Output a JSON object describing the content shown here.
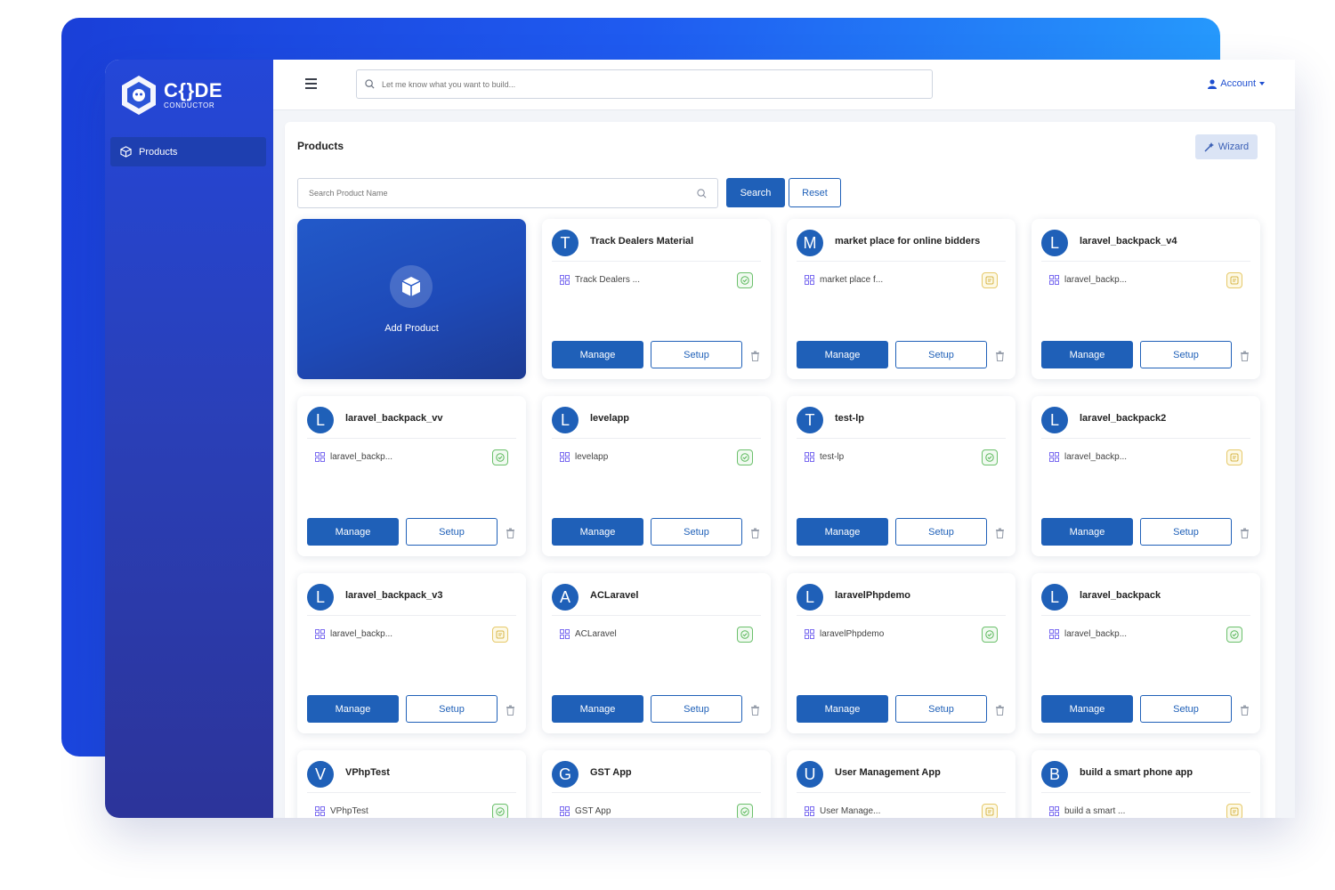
{
  "brand": {
    "name": "C{}DE",
    "tagline": "CONDUCTOR"
  },
  "sidebar": {
    "items": [
      {
        "label": "Products",
        "icon": "box-icon"
      }
    ]
  },
  "topbar": {
    "search_placeholder": "Let me know what you want to build...",
    "account_label": "Account"
  },
  "page": {
    "title": "Products",
    "wizard_label": "Wizard",
    "search_placeholder": "Search Product Name",
    "search_button": "Search",
    "reset_button": "Reset",
    "add_product_label": "Add Product"
  },
  "card_actions": {
    "manage": "Manage",
    "setup": "Setup"
  },
  "colors": {
    "primary": "#1f60b8",
    "sidebar": "#2a3fb6",
    "status_ok": "#6cc06c",
    "status_pending": "#e6c96a"
  },
  "products": [
    {
      "initial": "T",
      "name": "Track Dealers Material",
      "sub": "Track Dealers ...",
      "status": "ok"
    },
    {
      "initial": "M",
      "name": "market place for online bidders",
      "sub": "market place f...",
      "status": "pending"
    },
    {
      "initial": "L",
      "name": "laravel_backpack_v4",
      "sub": "laravel_backp...",
      "status": "pending"
    },
    {
      "initial": "L",
      "name": "laravel_backpack_vv",
      "sub": "laravel_backp...",
      "status": "ok"
    },
    {
      "initial": "L",
      "name": "levelapp",
      "sub": "levelapp",
      "status": "ok"
    },
    {
      "initial": "T",
      "name": "test-lp",
      "sub": "test-lp",
      "status": "ok"
    },
    {
      "initial": "L",
      "name": "laravel_backpack2",
      "sub": "laravel_backp...",
      "status": "pending"
    },
    {
      "initial": "L",
      "name": "laravel_backpack_v3",
      "sub": "laravel_backp...",
      "status": "pending"
    },
    {
      "initial": "A",
      "name": "ACLaravel",
      "sub": "ACLaravel",
      "status": "ok"
    },
    {
      "initial": "L",
      "name": "laravelPhpdemo",
      "sub": "laravelPhpdemo",
      "status": "ok"
    },
    {
      "initial": "L",
      "name": "laravel_backpack",
      "sub": "laravel_backp...",
      "status": "ok"
    },
    {
      "initial": "V",
      "name": "VPhpTest",
      "sub": "VPhpTest",
      "status": "ok"
    },
    {
      "initial": "G",
      "name": "GST App",
      "sub": "GST App",
      "status": "ok"
    },
    {
      "initial": "U",
      "name": "User Management App",
      "sub": "User Manage...",
      "status": "pending"
    },
    {
      "initial": "B",
      "name": "build a smart phone app",
      "sub": "build a smart ...",
      "status": "pending"
    }
  ]
}
